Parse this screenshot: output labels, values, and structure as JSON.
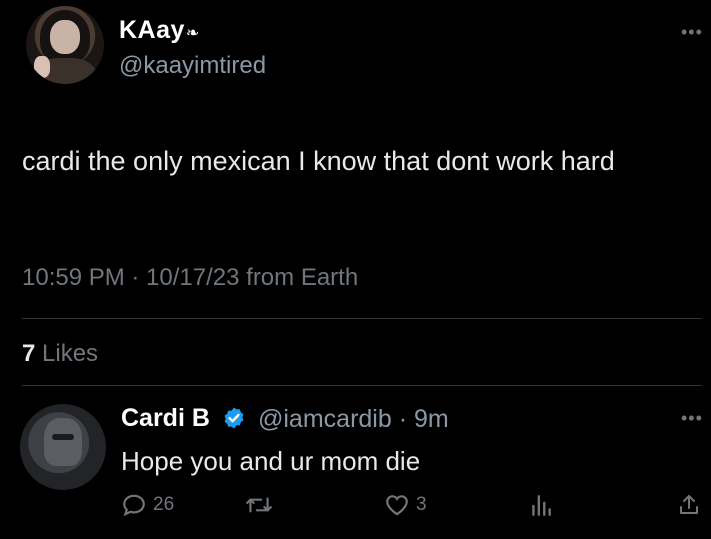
{
  "tweet": {
    "display_name": "KAay",
    "handle": "@kaayimtired",
    "text": "cardi the only mexican I know that dont work hard",
    "meta": "10:59 PM · 10/17/23 from Earth",
    "likes_count": "7",
    "likes_label": "Likes"
  },
  "reply": {
    "display_name": "Cardi B",
    "handle_time": "@iamcardib · 9m",
    "text": "Hope you and ur mom die",
    "reply_count": "26",
    "like_count": "3"
  },
  "icons": {
    "more": "more-horizontal-icon",
    "verified": "verified-badge-icon",
    "reply": "reply-icon",
    "retweet": "retweet-icon",
    "like": "heart-icon",
    "views": "views-icon",
    "share": "share-icon"
  },
  "colors": {
    "background": "#000000",
    "text": "#e7e9ea",
    "muted": "#71767b",
    "verified": "#1d9bf0"
  }
}
